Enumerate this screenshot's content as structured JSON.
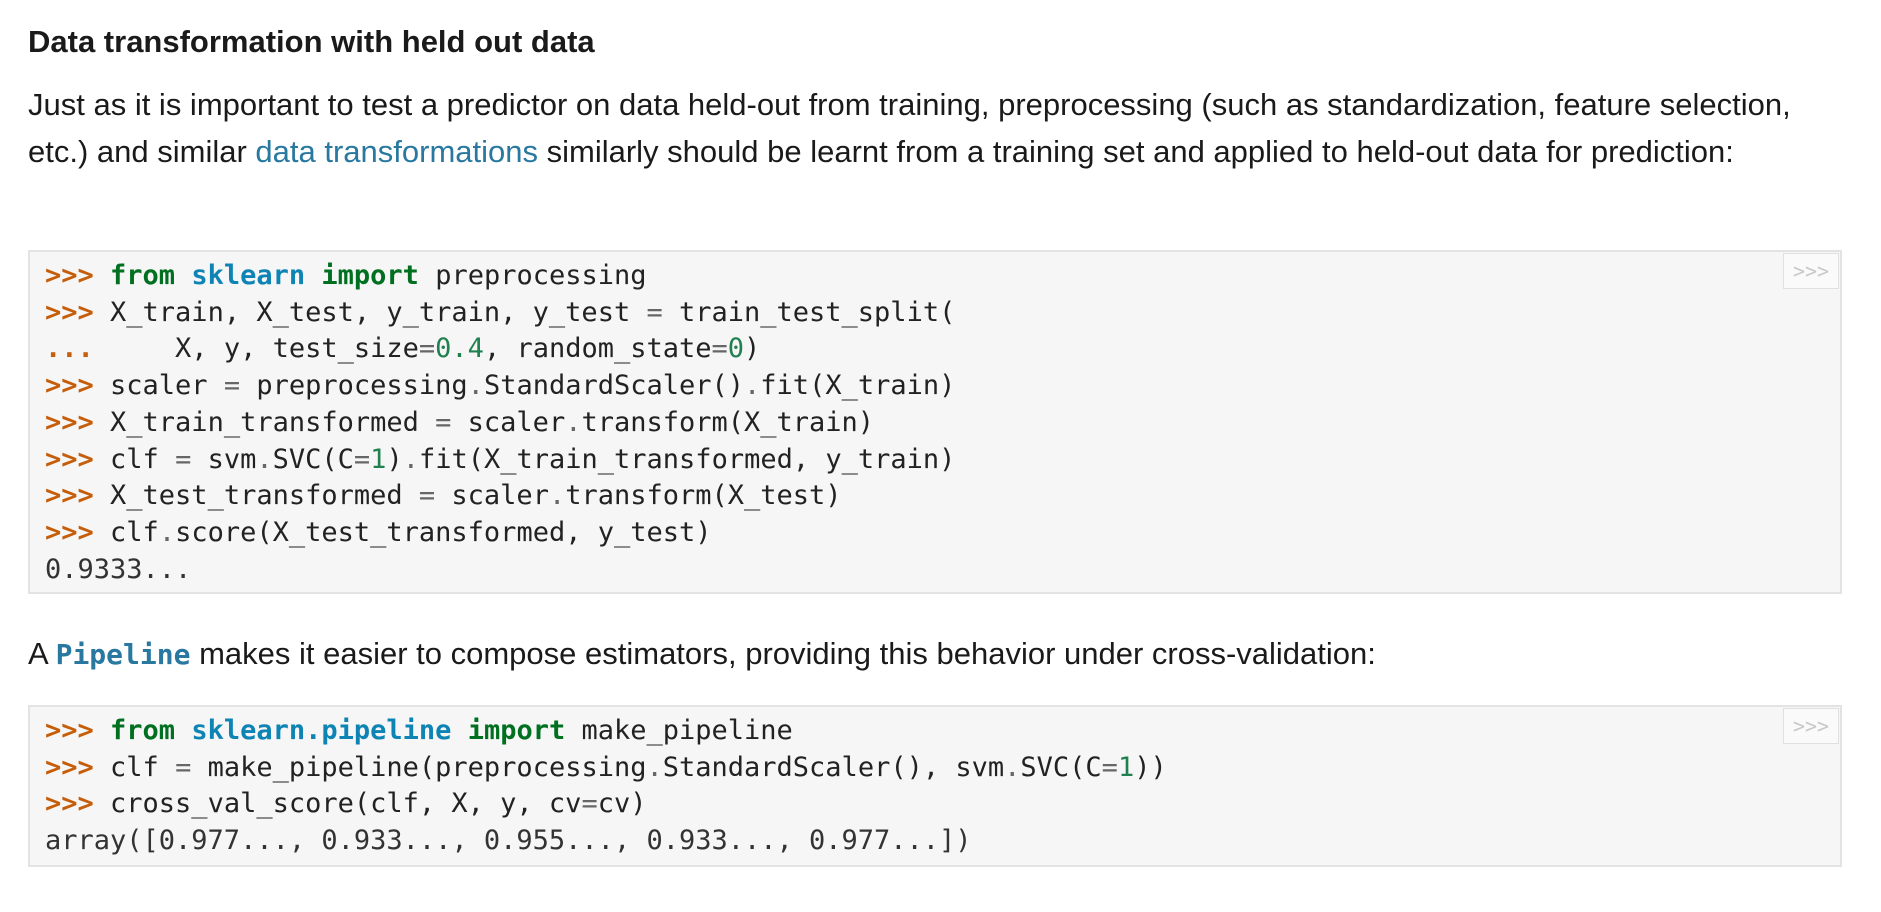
{
  "heading": "Data transformation with held out data",
  "para1": {
    "before": "Just as it is important to test a predictor on data held-out from training, preprocessing (such as standardization, feature selection, etc.) and similar ",
    "link": "data transformations",
    "after": " similarly should be learnt from a training set and applied to held-out data for prediction:"
  },
  "code1": {
    "copy_label": ">>>",
    "lines": [
      [
        [
          ">>> ",
          "gp"
        ],
        [
          "from",
          "kn"
        ],
        [
          " ",
          ""
        ],
        [
          "sklearn",
          "nn"
        ],
        [
          " ",
          ""
        ],
        [
          "import",
          "kn"
        ],
        [
          " preprocessing",
          ""
        ]
      ],
      [
        [
          ">>> ",
          "gp"
        ],
        [
          "X_train, X_test, y_train, y_test ",
          ""
        ],
        [
          "=",
          "o"
        ],
        [
          " train_test_split(",
          ""
        ]
      ],
      [
        [
          "... ",
          "gp"
        ],
        [
          "    X, y, test_size",
          ""
        ],
        [
          "=",
          "o"
        ],
        [
          "0.4",
          "mf"
        ],
        [
          ", random_state",
          ""
        ],
        [
          "=",
          "o"
        ],
        [
          "0",
          "mi"
        ],
        [
          ")",
          ""
        ]
      ],
      [
        [
          ">>> ",
          "gp"
        ],
        [
          "scaler ",
          ""
        ],
        [
          "=",
          "o"
        ],
        [
          " preprocessing",
          ""
        ],
        [
          ".",
          "o"
        ],
        [
          "StandardScaler()",
          ""
        ],
        [
          ".",
          "o"
        ],
        [
          "fit(X_train)",
          ""
        ]
      ],
      [
        [
          ">>> ",
          "gp"
        ],
        [
          "X_train_transformed ",
          ""
        ],
        [
          "=",
          "o"
        ],
        [
          " scaler",
          ""
        ],
        [
          ".",
          "o"
        ],
        [
          "transform(X_train)",
          ""
        ]
      ],
      [
        [
          ">>> ",
          "gp"
        ],
        [
          "clf ",
          ""
        ],
        [
          "=",
          "o"
        ],
        [
          " svm",
          ""
        ],
        [
          ".",
          "o"
        ],
        [
          "SVC(C",
          ""
        ],
        [
          "=",
          "o"
        ],
        [
          "1",
          "mi"
        ],
        [
          ")",
          ""
        ],
        [
          ".",
          "o"
        ],
        [
          "fit(X_train_transformed, y_train)",
          ""
        ]
      ],
      [
        [
          ">>> ",
          "gp"
        ],
        [
          "X_test_transformed ",
          ""
        ],
        [
          "=",
          "o"
        ],
        [
          " scaler",
          ""
        ],
        [
          ".",
          "o"
        ],
        [
          "transform(X_test)",
          ""
        ]
      ],
      [
        [
          ">>> ",
          "gp"
        ],
        [
          "clf",
          ""
        ],
        [
          ".",
          "o"
        ],
        [
          "score(X_test_transformed, y_test)",
          ""
        ]
      ],
      [
        [
          "0.9333...",
          "go"
        ]
      ]
    ]
  },
  "para2": {
    "before": "A ",
    "code_ref": "Pipeline",
    "after": " makes it easier to compose estimators, providing this behavior under cross-validation:"
  },
  "code2": {
    "copy_label": ">>>",
    "lines": [
      [
        [
          ">>> ",
          "gp"
        ],
        [
          "from",
          "kn"
        ],
        [
          " ",
          ""
        ],
        [
          "sklearn.pipeline",
          "nn"
        ],
        [
          " ",
          ""
        ],
        [
          "import",
          "kn"
        ],
        [
          " make_pipeline",
          ""
        ]
      ],
      [
        [
          ">>> ",
          "gp"
        ],
        [
          "clf ",
          ""
        ],
        [
          "=",
          "o"
        ],
        [
          " make_pipeline(preprocessing",
          ""
        ],
        [
          ".",
          "o"
        ],
        [
          "StandardScaler(), svm",
          ""
        ],
        [
          ".",
          "o"
        ],
        [
          "SVC(C",
          ""
        ],
        [
          "=",
          "o"
        ],
        [
          "1",
          "mi"
        ],
        [
          "))",
          ""
        ]
      ],
      [
        [
          ">>> ",
          "gp"
        ],
        [
          "cross_val_score(clf, X, y, cv",
          ""
        ],
        [
          "=",
          "o"
        ],
        [
          "cv)",
          ""
        ]
      ],
      [
        [
          "array([0.977..., 0.933..., 0.955..., 0.933..., 0.977...])",
          "go"
        ]
      ]
    ]
  }
}
